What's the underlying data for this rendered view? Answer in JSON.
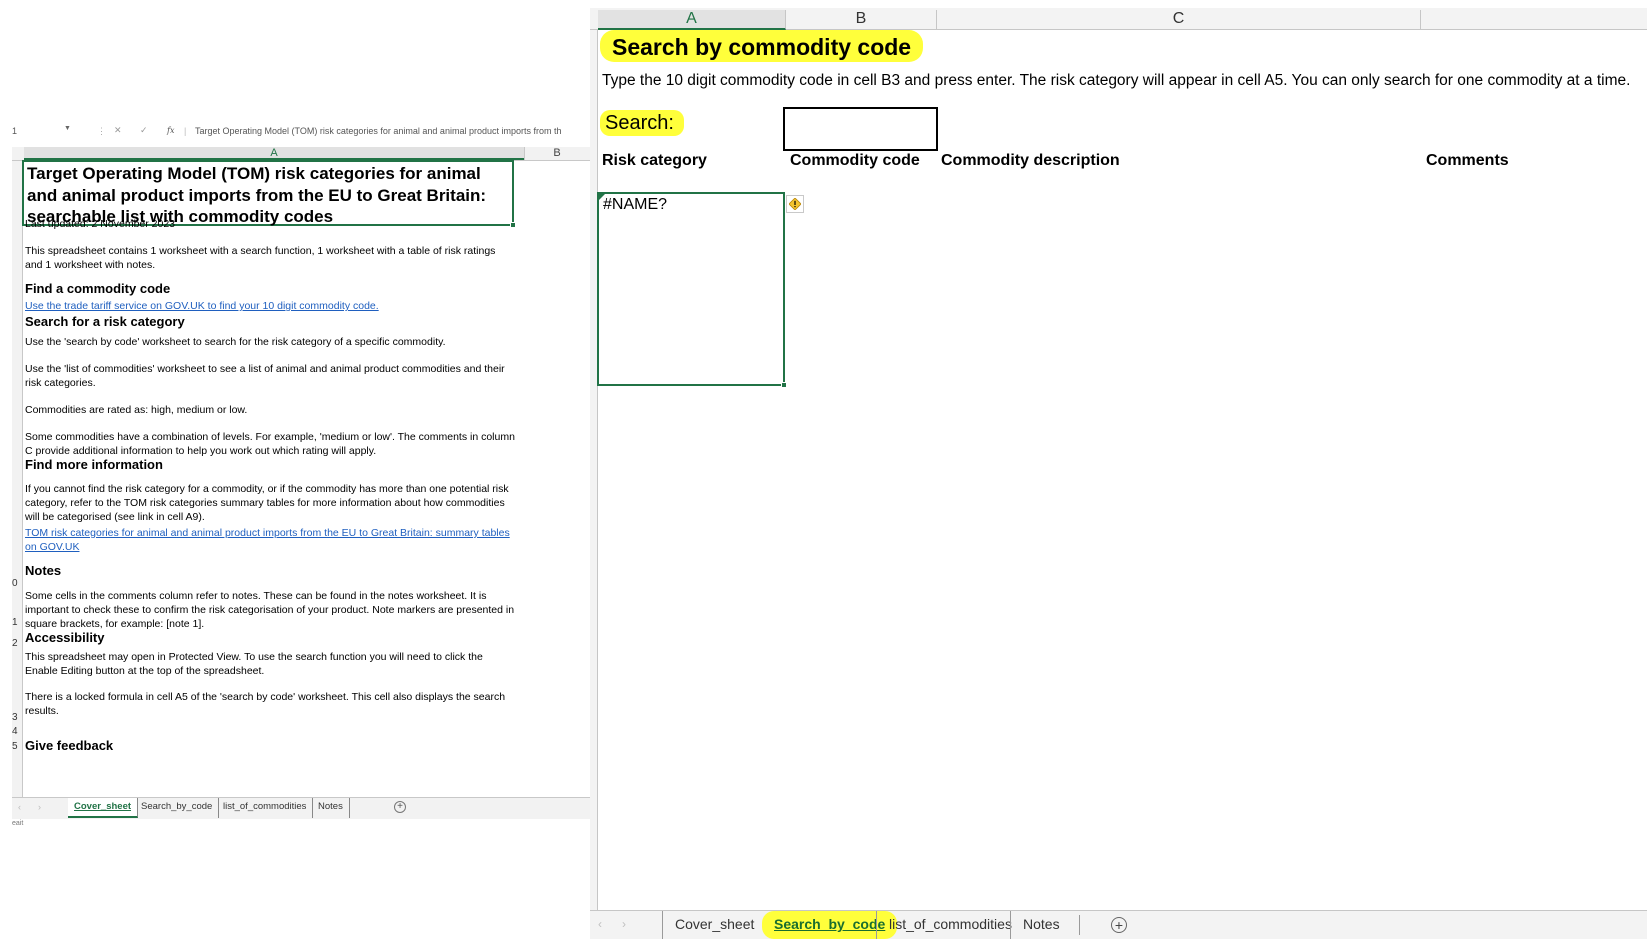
{
  "left": {
    "formula_bar": {
      "cell_ref": "1",
      "formula_text": "Target Operating Model (TOM) risk categories for animal and animal product imports from th"
    },
    "columns": [
      "A",
      "B"
    ],
    "row_numbers": [
      "0",
      "1",
      "2",
      "3",
      "4",
      "5"
    ],
    "title": "Target Operating Model (TOM) risk categories for animal and animal product imports from the EU to Great Britain: searchable list with commodity codes",
    "last_updated": "Last updated: 2 November 2023",
    "intro": "This spreadsheet contains 1 worksheet with a search function, 1 worksheet with a table of risk ratings and 1 worksheet with notes.",
    "find_code_heading": "Find a commodity code",
    "find_code_link": "Use the trade tariff service on GOV.UK to find your 10 digit commodity code.",
    "search_heading": "Search for a risk category",
    "search_text_1": "Use the 'search by code' worksheet to search for the risk category of a specific commodity.",
    "search_text_2": "Use the 'list of commodities' worksheet to see a list of animal and animal product commodities and their risk categories.",
    "search_text_3": "Commodities are rated as: high, medium or low.",
    "search_text_4": "Some commodities have a combination of levels. For example, 'medium or low'. The comments in column C provide additional information to help you work out which rating will apply.",
    "more_info_heading": "Find more information",
    "more_info_text": "If you cannot find the risk category for a commodity, or if the commodity has more than one potential risk category, refer to the TOM risk categories summary tables for more information about how commodities will be categorised (see link in cell A9).",
    "more_info_link": "TOM risk categories for animal and animal product imports from the EU to Great Britain: summary tables on GOV.UK",
    "notes_heading": "Notes",
    "notes_text": "Some cells in the comments column refer to notes. These can be found in the notes worksheet. It is important to check these to confirm the risk categorisation of your product. Note markers are presented in square brackets, for example: [note 1].",
    "accessibility_heading": "Accessibility",
    "accessibility_text_1": "This spreadsheet may open in Protected View. To use the search function you will need to click the Enable Editing button at the top of the spreadsheet.",
    "accessibility_text_2": "There is a locked formula in cell A5 of the 'search by code' worksheet. This cell also displays the search results.",
    "feedback_heading": "Give feedback",
    "tabs": [
      "Cover_sheet",
      "Search_by_code",
      "list_of_commodities",
      "Notes"
    ],
    "active_tab": "Cover_sheet",
    "status_text": "eait"
  },
  "right": {
    "columns": [
      "A",
      "B",
      "C"
    ],
    "title": "Search by commodity code",
    "instructions": "Type the 10 digit commodity code in cell B3 and press enter. The risk category will appear in cell A5. You can only search for one commodity at a time.",
    "search_label": "Search:",
    "search_value": "",
    "headers": {
      "risk_category": "Risk category",
      "commodity_code": "Commodity code",
      "commodity_description": "Commodity description",
      "comments": "Comments"
    },
    "result_value": "#NAME?",
    "tabs": [
      "Cover_sheet",
      "Search_by_code",
      "list_of_commodities",
      "Notes"
    ],
    "active_tab": "Search_by_code"
  },
  "colors": {
    "excel_green": "#217346",
    "highlight_yellow": "#ffff3b",
    "link_blue": "#1f5fbf"
  },
  "icons": [
    "cancel-icon",
    "enter-icon",
    "function-icon",
    "error-warning-icon",
    "add-sheet-icon",
    "scroll-left-icon",
    "scroll-right-icon"
  ]
}
